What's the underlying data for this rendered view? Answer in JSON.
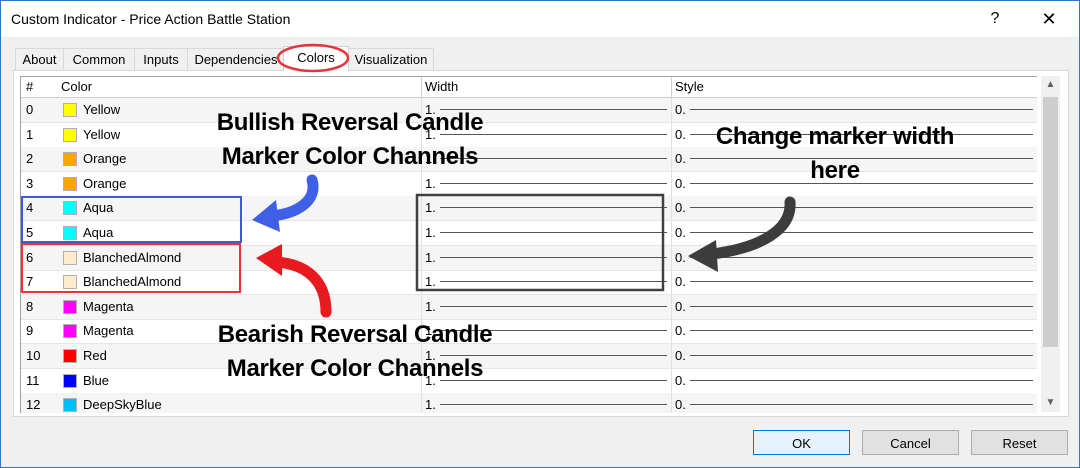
{
  "window": {
    "title": "Custom Indicator - Price Action Battle Station",
    "help_label": "?",
    "close_label": "✕"
  },
  "tabs": [
    {
      "label": "About"
    },
    {
      "label": "Common"
    },
    {
      "label": "Inputs"
    },
    {
      "label": "Dependencies"
    },
    {
      "label": "Colors",
      "active": true
    },
    {
      "label": "Visualization"
    }
  ],
  "grid": {
    "headers": {
      "num": "#",
      "color": "Color",
      "width": "Width",
      "style": "Style"
    },
    "rows": [
      {
        "num": "0",
        "color_name": "Yellow",
        "hex": "#ffff00",
        "width": "1.",
        "style": "0."
      },
      {
        "num": "1",
        "color_name": "Yellow",
        "hex": "#ffff00",
        "width": "1.",
        "style": "0."
      },
      {
        "num": "2",
        "color_name": "Orange",
        "hex": "#ffa500",
        "width": "1.",
        "style": "0."
      },
      {
        "num": "3",
        "color_name": "Orange",
        "hex": "#ffa500",
        "width": "1.",
        "style": "0."
      },
      {
        "num": "4",
        "color_name": "Aqua",
        "hex": "#00ffff",
        "width": "1.",
        "style": "0."
      },
      {
        "num": "5",
        "color_name": "Aqua",
        "hex": "#00ffff",
        "width": "1.",
        "style": "0."
      },
      {
        "num": "6",
        "color_name": "BlanchedAlmond",
        "hex": "#ffebcd",
        "width": "1.",
        "style": "0."
      },
      {
        "num": "7",
        "color_name": "BlanchedAlmond",
        "hex": "#ffebcd",
        "width": "1.",
        "style": "0."
      },
      {
        "num": "8",
        "color_name": "Magenta",
        "hex": "#ff00ff",
        "width": "1.",
        "style": "0."
      },
      {
        "num": "9",
        "color_name": "Magenta",
        "hex": "#ff00ff",
        "width": "1.",
        "style": "0."
      },
      {
        "num": "10",
        "color_name": "Red",
        "hex": "#ff0000",
        "width": "1.",
        "style": "0."
      },
      {
        "num": "11",
        "color_name": "Blue",
        "hex": "#0000ff",
        "width": "1.",
        "style": "0."
      },
      {
        "num": "12",
        "color_name": "DeepSkyBlue",
        "hex": "#00bfff",
        "width": "1.",
        "style": "0."
      }
    ]
  },
  "buttons": {
    "ok": "OK",
    "cancel": "Cancel",
    "reset": "Reset"
  },
  "annotations": {
    "bullish_line1": "Bullish Reversal Candle",
    "bullish_line2": "Marker Color Channels",
    "width_line1": "Change marker width",
    "width_line2": "here",
    "bearish_line1": "Bearish Reversal Candle",
    "bearish_line2": "Marker Color Channels"
  },
  "annotation_colors": {
    "tab_highlight": "#e8333a",
    "bullish_box": "#3b5bdb",
    "bearish_box": "#e8333a",
    "width_box": "#404040",
    "bullish_arrow": "#3f5fe6",
    "bearish_arrow": "#e8191f",
    "width_arrow": "#3c3c3c"
  }
}
